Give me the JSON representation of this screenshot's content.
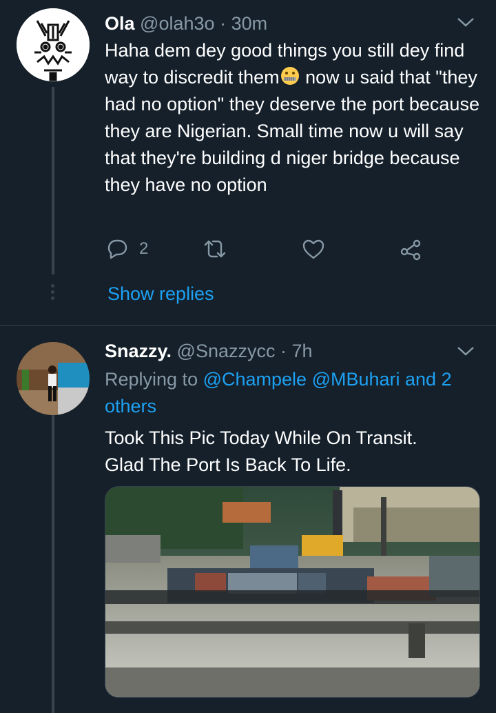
{
  "tweets": [
    {
      "display_name": "Ola",
      "handle": "@olah3o",
      "separator": "·",
      "time": "30m",
      "text_part1": "Haha dem dey good things you still dey find way to discredit them",
      "text_part2": " now u said that \"they had no option\" they deserve the port because they are Nigerian. Small time now u will say that they're building d niger bridge because they have no option",
      "emoji": "zipper-mouth-face",
      "reply_count": "2",
      "show_replies_label": "Show replies"
    },
    {
      "display_name": "Snazzy.",
      "handle": "@Snazzycc",
      "separator": "·",
      "time": "7h",
      "replying_prefix": "Replying to ",
      "reply_targets": "@Champele @MBuhari and 2 others",
      "text_line1": "Took This Pic Today While On Transit.",
      "text_line2": "Glad The Port Is Back To Life."
    }
  ],
  "icons": {
    "reply": "reply-icon",
    "retweet": "retweet-icon",
    "like": "heart-icon",
    "share": "share-icon",
    "menu": "chevron-down-icon"
  },
  "colors": {
    "background": "#15202b",
    "accent": "#1da1f2",
    "muted": "#8899a6",
    "divider": "#38444d"
  }
}
